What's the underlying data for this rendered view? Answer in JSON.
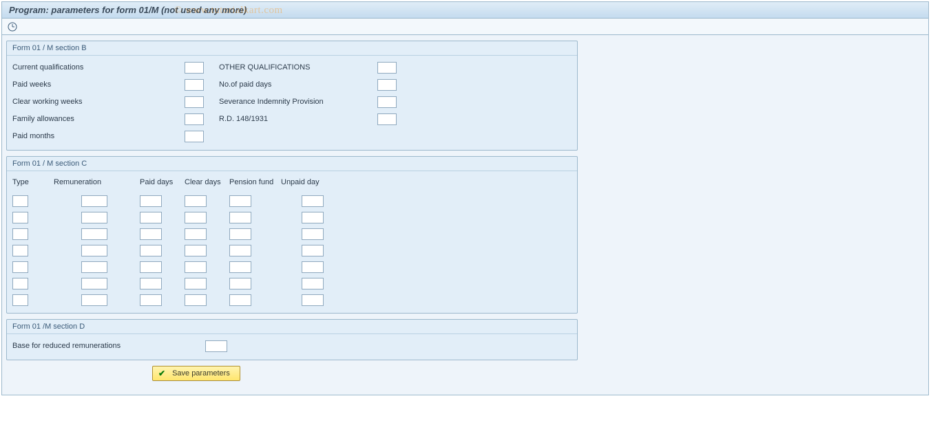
{
  "header": {
    "title": "Program: parameters for form 01/M (not used any more)",
    "watermark": "© www.tutorialkart.com"
  },
  "sectionB": {
    "title": "Form 01 / M section B",
    "rows": [
      {
        "label1": "Current qualifications",
        "label2": "OTHER QUALIFICATIONS"
      },
      {
        "label1": "Paid weeks",
        "label2": "No.of paid days"
      },
      {
        "label1": "Clear working weeks",
        "label2": "Severance Indemnity Provision"
      },
      {
        "label1": "Family allowances",
        "label2": "R.D. 148/1931"
      },
      {
        "label1": "Paid months",
        "label2": ""
      }
    ]
  },
  "sectionC": {
    "title": "Form 01 / M section C",
    "headers": {
      "type": "Type",
      "remuneration": "Remuneration",
      "paid_days": "Paid days",
      "clear_days": "Clear days",
      "pension_fund": "Pension fund",
      "unpaid_day": "Unpaid day"
    },
    "row_count": 7
  },
  "sectionD": {
    "title": "Form 01 /M section D",
    "label": "Base for reduced remunerations"
  },
  "actions": {
    "save": "Save parameters"
  }
}
